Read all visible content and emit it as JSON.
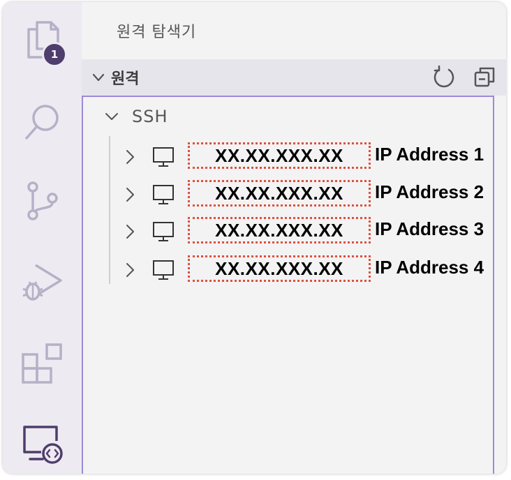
{
  "activity_bar": {
    "items": [
      {
        "icon": "explorer-icon",
        "badge": "1"
      },
      {
        "icon": "search-icon"
      },
      {
        "icon": "source-control-icon"
      },
      {
        "icon": "run-debug-icon"
      },
      {
        "icon": "extensions-icon"
      },
      {
        "icon": "remote-explorer-icon",
        "active": true
      }
    ]
  },
  "sidebar": {
    "title": "원격 탐색기",
    "section": {
      "label": "원격",
      "actions": [
        "refresh-icon",
        "collapse-all-icon"
      ]
    },
    "tree": {
      "group_label": "SSH",
      "hosts": [
        {
          "address": "XX.XX.XXX.XX",
          "name": "IP Address 1"
        },
        {
          "address": "XX.XX.XXX.XX",
          "name": "IP Address 2"
        },
        {
          "address": "XX.XX.XXX.XX",
          "name": "IP Address 3"
        },
        {
          "address": "XX.XX.XXX.XX",
          "name": "IP Address 4"
        }
      ]
    }
  },
  "colors": {
    "activity_bar_bg": "#edebf1",
    "sidebar_bg": "#f3f3f3",
    "section_header_bg": "#e7e5ec",
    "badge_bg": "#4f3d6e",
    "focus_border": "#9d8ad6",
    "icon_stroke": "#b6b0c8",
    "highlight_dotted": "#dc5040"
  }
}
